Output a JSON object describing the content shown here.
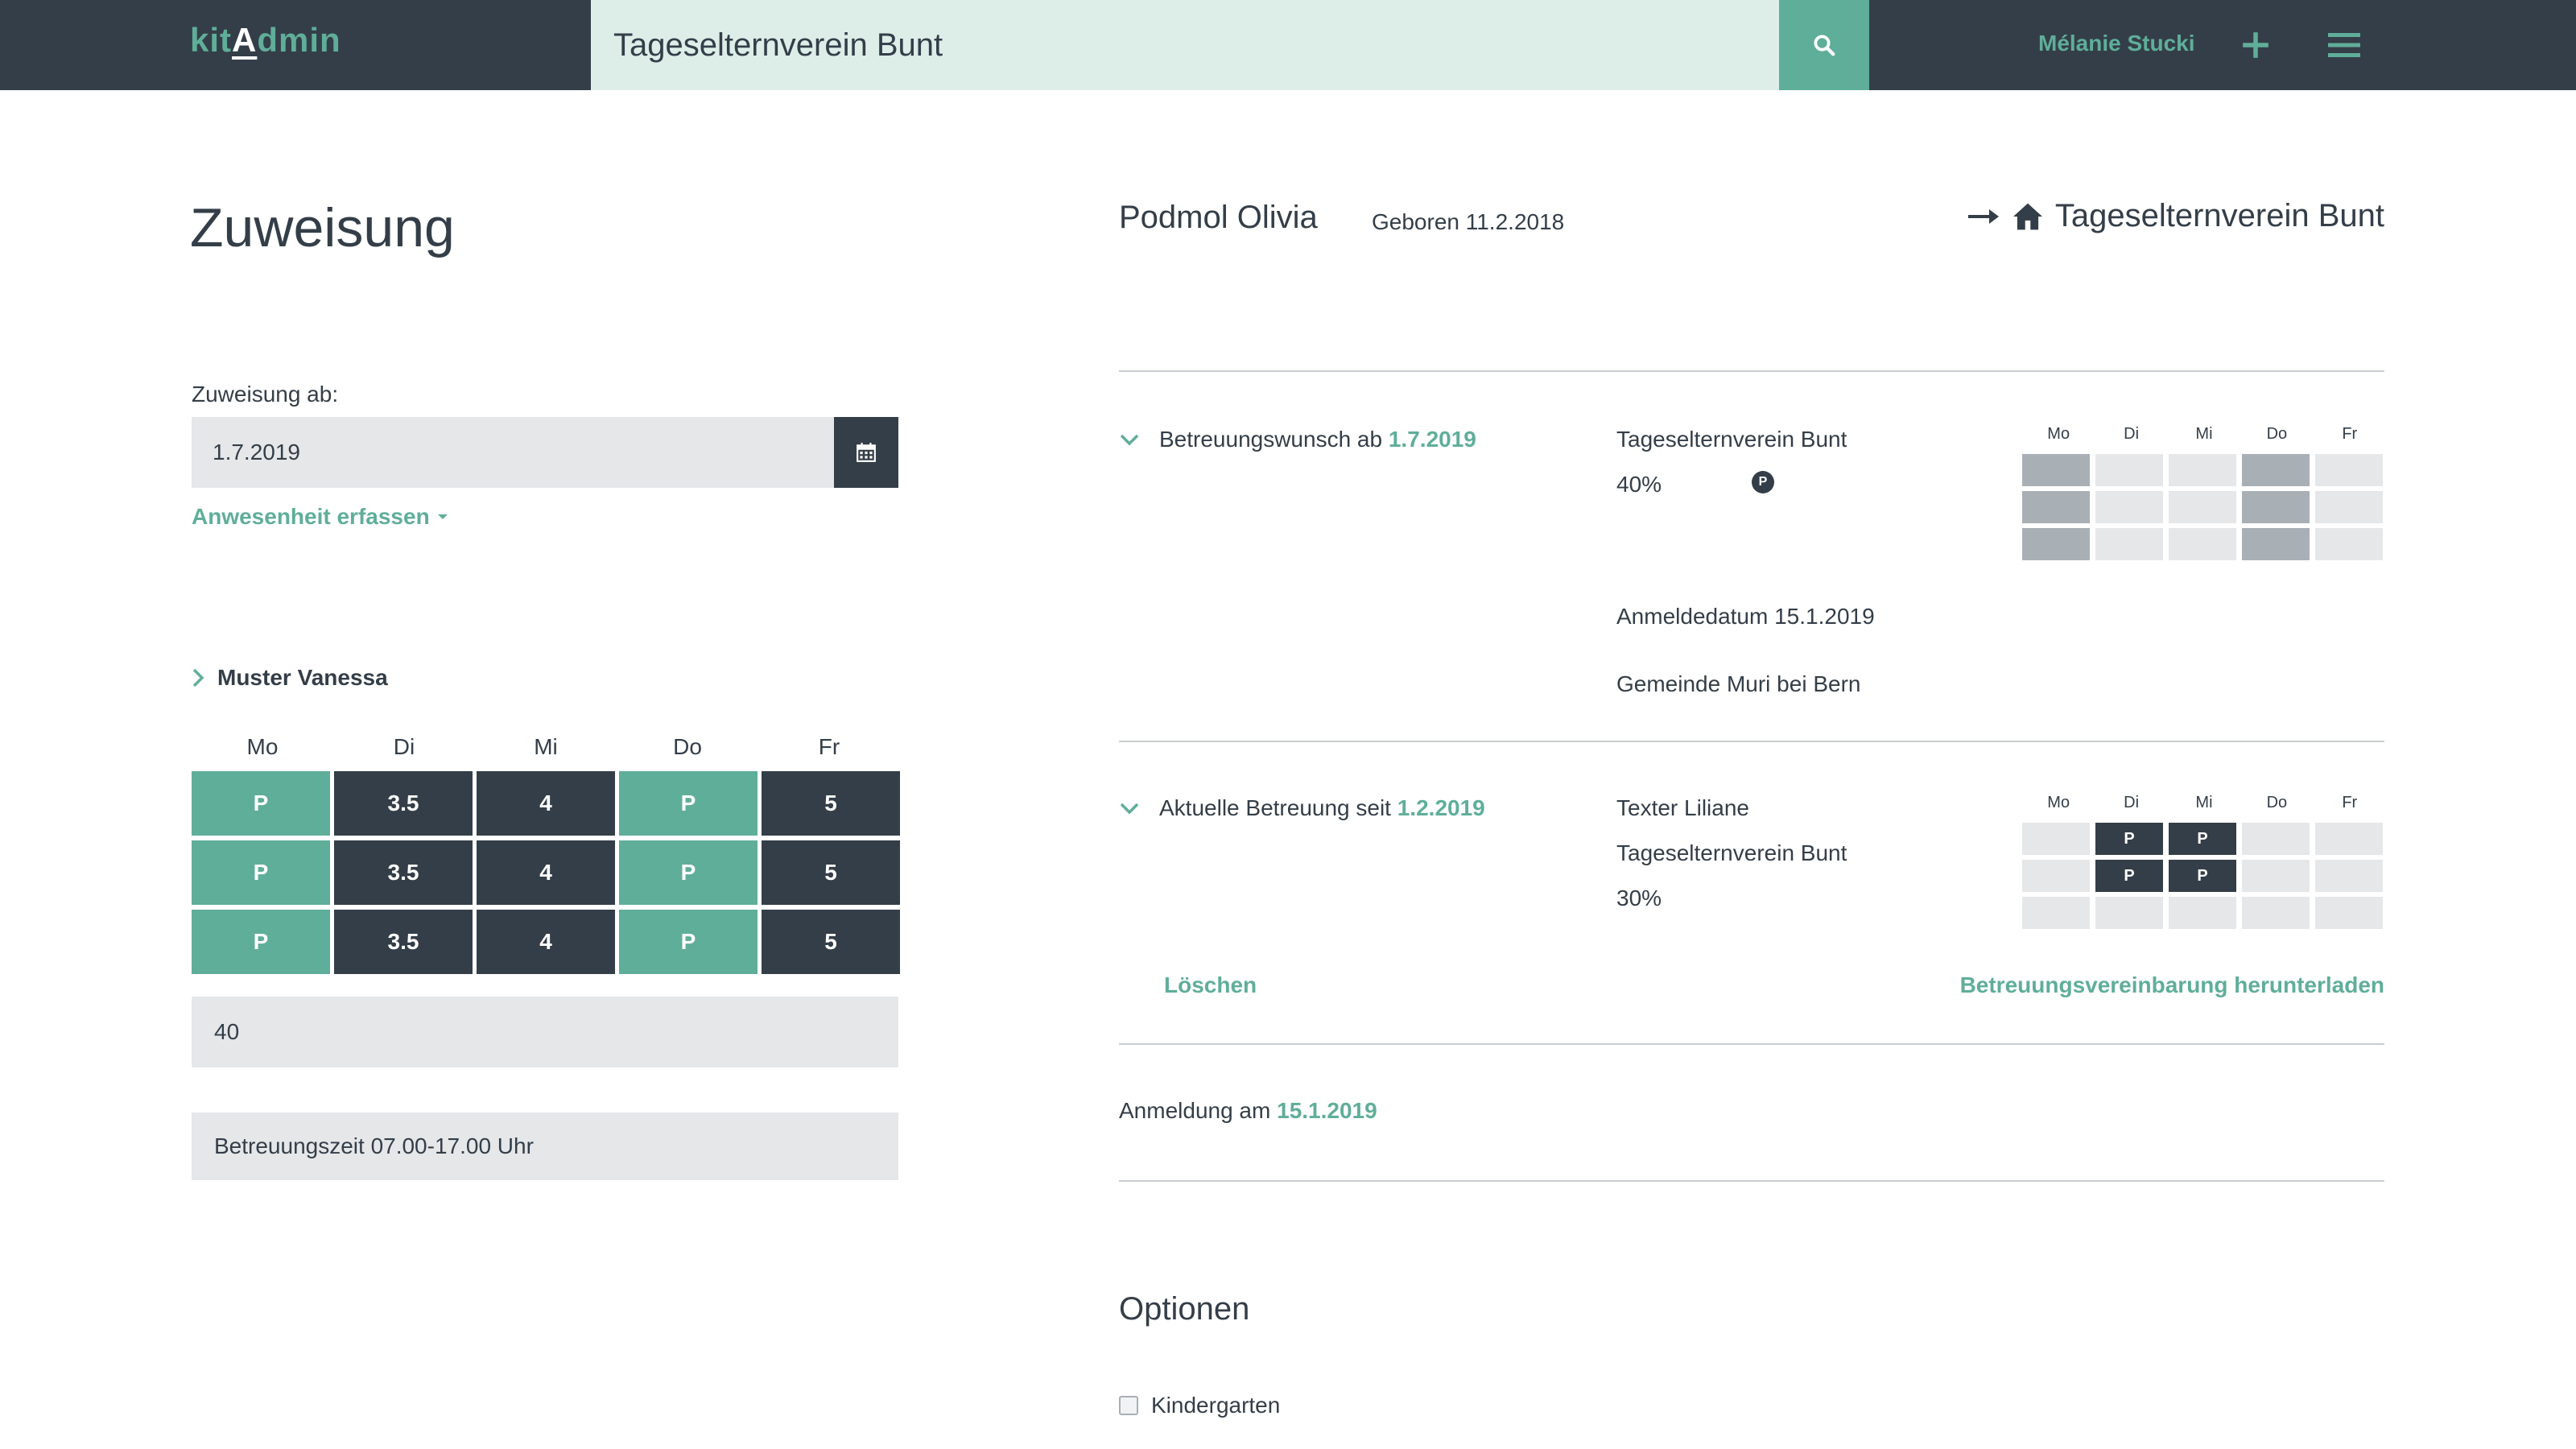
{
  "header": {
    "logo_pre": "kit",
    "logo_cap": "A",
    "logo_post": "dmin",
    "search_value": "Tageselternverein Bunt",
    "user_name": "Mélanie Stucki"
  },
  "left": {
    "title": "Zuweisung",
    "date_label": "Zuweisung ab:",
    "date_value": "1.7.2019",
    "presence_link": "Anwesenheit erfassen",
    "person_name": "Muster Vanessa",
    "days": [
      "Mo",
      "Di",
      "Mi",
      "Do",
      "Fr"
    ],
    "grid": [
      [
        "P",
        "3.5",
        "4",
        "P",
        "5"
      ],
      [
        "P",
        "3.5",
        "4",
        "P",
        "5"
      ],
      [
        "P",
        "3.5",
        "4",
        "P",
        "5"
      ]
    ],
    "sum_value": "40",
    "care_time": "Betreuungszeit 07.00-17.00 Uhr"
  },
  "right": {
    "child_name": "Podmol Olivia",
    "child_born": "Geboren 11.2.2018",
    "institution": "Tageselternverein Bunt",
    "wish": {
      "label": "Betreuungswunsch ab",
      "date": "1.7.2019",
      "institution": "Tageselternverein Bunt",
      "percent": "40%",
      "badge": "P",
      "registration_date": "Anmeldedatum 15.1.2019",
      "municipality": "Gemeinde Muri bei Bern"
    },
    "current": {
      "label": "Aktuelle Betreuung seit",
      "date": "1.2.2019",
      "caregiver": "Texter Liliane",
      "institution": "Tageselternverein Bunt",
      "percent": "30%",
      "delete_label": "Löschen",
      "download_label": "Betreuungsvereinbarung herunterladen"
    },
    "mini_days": [
      "Mo",
      "Di",
      "Mi",
      "Do",
      "Fr"
    ],
    "wish_grid": [
      [
        "gray",
        "light",
        "light",
        "gray",
        "light"
      ],
      [
        "gray",
        "light",
        "light",
        "gray",
        "light"
      ],
      [
        "gray",
        "light",
        "light",
        "gray",
        "light"
      ]
    ],
    "current_grid": [
      [
        "",
        "P",
        "P",
        "",
        ""
      ],
      [
        "",
        "P",
        "P",
        "",
        ""
      ],
      [
        "",
        "",
        "",
        "",
        ""
      ]
    ],
    "registered_label": "Anmeldung am",
    "registered_date": "15.1.2019",
    "options_title": "Optionen",
    "kindergarten_label": "Kindergarten"
  },
  "colors": {
    "accent": "#5fae99",
    "dark": "#343e48",
    "light_gray": "#e5e7e9",
    "mid_gray": "#a8afb5",
    "search_bg": "#ddeee9"
  }
}
